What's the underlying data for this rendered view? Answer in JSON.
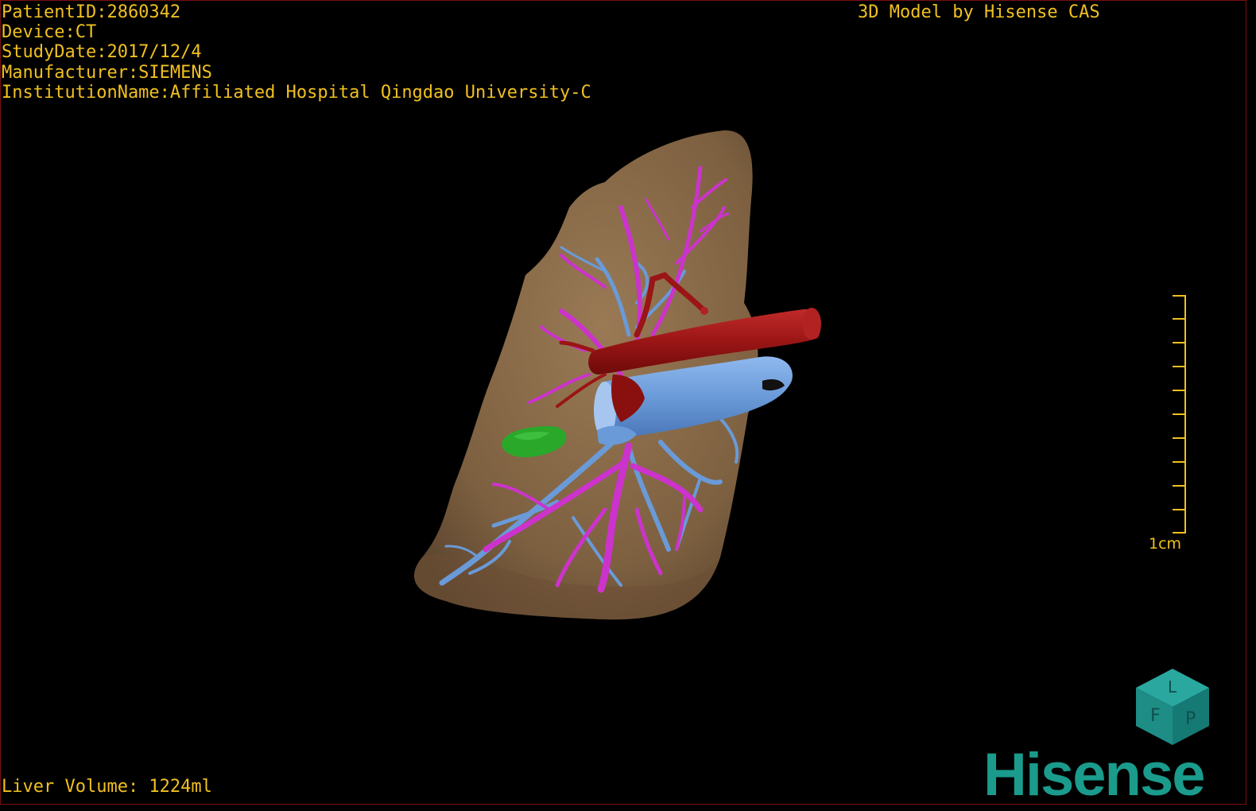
{
  "overlay": {
    "patient_id": "PatientID:2860342",
    "device": "Device:CT",
    "study_date": "StudyDate:2017/12/4",
    "manufacturer": "Manufacturer:SIEMENS",
    "institution": "InstitutionName:Affiliated Hospital Qingdao University-C",
    "credit": "3D Model by Hisense CAS",
    "liver_volume": "Liver Volume: 1224ml"
  },
  "scale": {
    "label": "1cm"
  },
  "orientation_cube": {
    "face_labels": [
      "F",
      "L",
      "P"
    ]
  },
  "brand": {
    "logo_text": "Hisense"
  },
  "colors": {
    "overlay_text": "#f0c020",
    "liver": "#8a6a48",
    "portal_vein": "#cc33cc",
    "hepatic_vein": "#6a9ad8",
    "artery": "#a01818",
    "lesion": "#2aa82a",
    "brand": "#1a9b8c"
  }
}
